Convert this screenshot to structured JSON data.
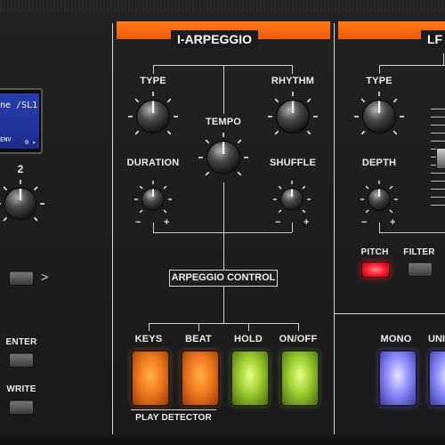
{
  "display": {
    "line1": "ne /SL1",
    "line2": "ENV",
    "line3": "0 ▸"
  },
  "left_column": {
    "knob_number": "2",
    "arrow_glyph": ">",
    "enter_label": "ENTER",
    "write_label": "WRITE"
  },
  "arpeggio_section": {
    "title": "I-ARPEGGIO",
    "knobs": {
      "type": "TYPE",
      "rhythm": "RHYTHM",
      "tempo": "TEMPO",
      "duration": "DURATION",
      "shuffle": "SHUFFLE"
    },
    "scale_minus": "−",
    "scale_plus": "+",
    "control_label": "ARPEGGIO CONTROL",
    "pads": {
      "keys": "KEYS",
      "beat": "BEAT",
      "hold": "HOLD",
      "on_off": "ON/OFF"
    },
    "play_detector_label": "PLAY DETECTOR"
  },
  "lfo_section": {
    "title_partial": "LF",
    "type_label": "TYPE",
    "depth_label": "DEPTH",
    "pitch_label": "PITCH",
    "filter_label": "FILTER",
    "mono_label": "MONO",
    "unison_label_partial": "UNI"
  },
  "colors": {
    "banner_orange": "#f26a10",
    "pad_orange": "#f07a1e",
    "pad_green": "#9ccc2e",
    "pad_blue": "#8f8cff",
    "led_red": "#ff2030"
  }
}
